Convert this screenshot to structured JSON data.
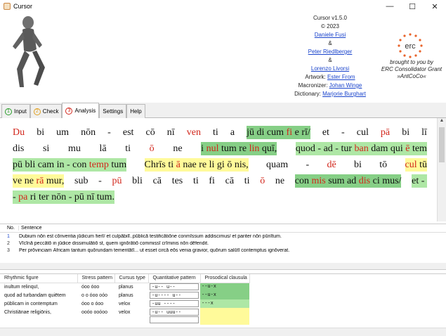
{
  "window": {
    "title": "Cursor",
    "min": "—",
    "max": "☐",
    "close": "✕"
  },
  "credits": {
    "version": "Cursor v1.5.0",
    "copyright": "© 2023",
    "author1": "Daniele Fusi",
    "amp1": "&",
    "author2": "Peter Riedlberger",
    "amp2": "&",
    "author3": "Lorenzo Livorsi",
    "artwork_label": "Artwork:",
    "artwork": "Ester From",
    "macronizer_label": "Macronizer:",
    "macronizer": "Johan Winge",
    "dictionary_label": "Dictionary:",
    "dictionary": "Marjorie Burghart"
  },
  "erc": {
    "logo": "erc",
    "line1": "brought to you by",
    "line2": "ERC Consolidator Grant",
    "line3": "»AntCoCo«"
  },
  "tabs": [
    {
      "num": "1",
      "label": "Input",
      "color": "#2a9d2a"
    },
    {
      "num": "2",
      "label": "Check",
      "color": "#e0a020"
    },
    {
      "num": "3",
      "label": "Analysis",
      "color": "#d2261b"
    },
    {
      "label": "Settings"
    },
    {
      "label": "Help"
    }
  ],
  "text_lines": [
    [
      {
        "t": "Du",
        "c": "r"
      },
      {
        "t": "bi"
      },
      {
        "t": "um"
      },
      {
        "t": "nōn"
      },
      {
        "t": "-"
      },
      {
        "t": "est"
      },
      {
        "t": "cō"
      },
      {
        "t": "nī"
      },
      {
        "t": "ven",
        "c": "r"
      },
      {
        "t": "ti"
      },
      {
        "t": "a"
      },
      {
        "t": "jū di cum ",
        "bg": "g"
      },
      {
        "t": "fi",
        "c": "r",
        "bg": "g"
      },
      {
        "t": " e rī/",
        "bg": "g"
      },
      {
        "t": "et"
      },
      {
        "t": "-"
      },
      {
        "t": "cul"
      },
      {
        "t": "pā",
        "c": "r"
      },
      {
        "t": "bi"
      },
      {
        "t": "lī"
      }
    ],
    [
      {
        "t": "dis"
      },
      {
        "t": "si"
      },
      {
        "t": "mu"
      },
      {
        "t": "lā"
      },
      {
        "t": "ti"
      },
      {
        "t": "ō",
        "c": "r"
      },
      {
        "t": "ne"
      },
      {
        "t": "i ",
        "bg": "g"
      },
      {
        "t": "nul",
        "c": "r",
        "bg": "g"
      },
      {
        "t": " tum re ",
        "bg": "g"
      },
      {
        "t": "lin",
        "c": "r",
        "bg": "g"
      },
      {
        "t": " quī,",
        "bg": "g"
      },
      {
        "t": "quod - ad - tur ",
        "bg": "lg"
      },
      {
        "t": "ban",
        "c": "r",
        "bg": "lg"
      },
      {
        "t": " dam qui ",
        "bg": "lg"
      },
      {
        "t": "ē",
        "c": "r",
        "bg": "lg"
      },
      {
        "t": " tem",
        "bg": "lg"
      }
    ],
    [
      {
        "t": "pū bli cam in - con ",
        "bg": "lg"
      },
      {
        "t": "temp",
        "c": "r",
        "bg": "lg"
      },
      {
        "t": " tum",
        "bg": "lg"
      },
      {
        "t": "Chrīs ti ",
        "bg": "y"
      },
      {
        "t": "ā",
        "c": "r",
        "bg": "y"
      },
      {
        "t": " nae re li gi ō nis,",
        "bg": "y"
      },
      {
        "t": "quam"
      },
      {
        "t": "-"
      },
      {
        "t": "dē",
        "c": "r"
      },
      {
        "t": "bi"
      },
      {
        "t": "tō"
      },
      {
        "t": "cul",
        "c": "r",
        "bg": "y"
      },
      {
        "t": " tū",
        "bg": "y"
      }
    ],
    [
      {
        "t": "ve ne ",
        "bg": "y"
      },
      {
        "t": "rā",
        "c": "r",
        "bg": "y"
      },
      {
        "t": " mur,",
        "bg": "y"
      },
      {
        "t": "sub"
      },
      {
        "t": "-"
      },
      {
        "t": "pū",
        "c": "r"
      },
      {
        "t": "bli"
      },
      {
        "t": "cā"
      },
      {
        "t": "tes"
      },
      {
        "t": "ti"
      },
      {
        "t": "fi"
      },
      {
        "t": "cā"
      },
      {
        "t": "ti"
      },
      {
        "t": "ō",
        "c": "r"
      },
      {
        "t": "ne"
      },
      {
        "t": "con ",
        "bg": "g"
      },
      {
        "t": "mis",
        "c": "r",
        "bg": "g"
      },
      {
        "t": " sum ad ",
        "bg": "g"
      },
      {
        "t": "dis",
        "c": "r",
        "bg": "g"
      },
      {
        "t": " ci mus/",
        "bg": "g"
      },
      {
        "t": "et - ",
        "bg": "lg"
      }
    ],
    [
      {
        "t": "- ",
        "bg": "lg"
      },
      {
        "t": "pa",
        "c": "r",
        "bg": "lg"
      },
      {
        "t": " ri ter nōn - pū nī tum.",
        "bg": "lg"
      }
    ]
  ],
  "sentences": {
    "col_no": "No.",
    "col_sentence": "Sentence",
    "rows": [
      {
        "no": "1",
        "text": "Dubium nōn est cōnventia jūdicum fierī/ et culpābilī..pūblicā testificātiōne conmīssum addiscimus/ et pariter nōn pūnītum."
      },
      {
        "no": "2",
        "text": "Vīcīnā peccātō in jūdice dissimulātiō  st, quem ignōrātiō commissī crīminis nōn dēfendit."
      },
      {
        "no": "3",
        "text": "Per prōvinciam Āfricam tantum quōrundam temeritātī... ut esset circā eōs venia gravior, quōrum salūtī contemptus ignōverat."
      }
    ]
  },
  "clausulae": {
    "headers": [
      "Rhythmic figure",
      "Stress pattern",
      "Cursus type",
      "Quantitative pattern",
      "Prosodical clausula"
    ],
    "rows": [
      {
        "figure": "inultum relinquī,",
        "stress": "óoo óoo",
        "cursus": "planus",
        "quant": "-u-- u--",
        "pros": "--u-x",
        "pbg": "#86cf86"
      },
      {
        "figure": "quod ad turbandam quiētem",
        "stress": "o o óoo oóo",
        "cursus": "planus",
        "quant": "-u---- u--",
        "pros": "--u-x",
        "pbg": "#86cf86"
      },
      {
        "figure": "pūblicam in contemptum",
        "stress": "óoo o óoo",
        "cursus": "velox",
        "quant": "-uu ----",
        "pros": "---x",
        "pbg": "#aee7a5"
      },
      {
        "figure": "Christiānae religiōnis,",
        "stress": "ooóo ooóoo",
        "cursus": "velox",
        "quant": "-u-- uuu--",
        "pros": "",
        "pbg": "#fffa9a"
      },
      {
        "figure": "",
        "stress": "",
        "cursus": "",
        "quant": "",
        "pros": "",
        "pbg": "#fffa9a"
      }
    ]
  }
}
